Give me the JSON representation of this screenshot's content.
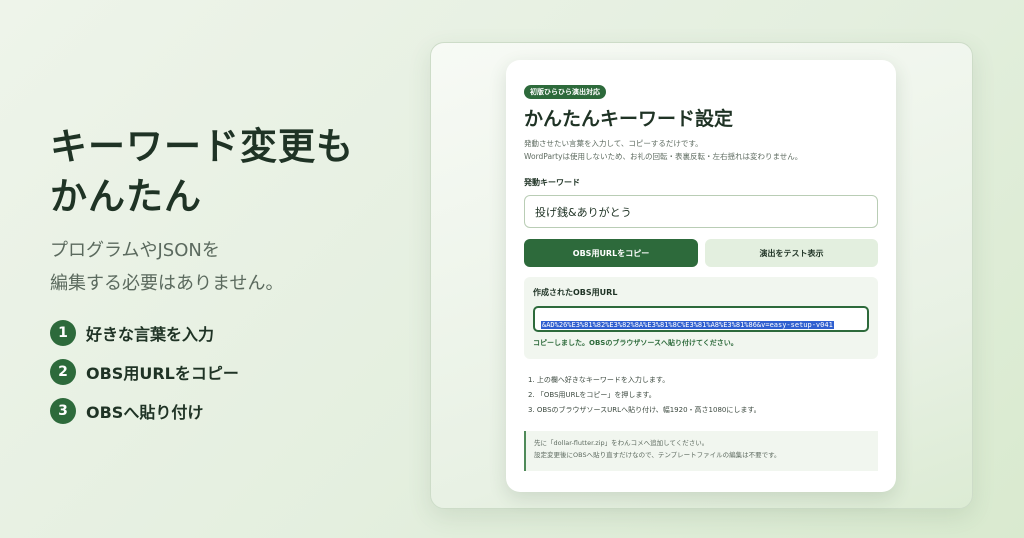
{
  "hero": {
    "title_line1": "キーワード変更も",
    "title_line2": "かんたん",
    "subtitle_line1": "プログラムやJSONを",
    "subtitle_line2": "編集する必要はありません。",
    "steps": [
      {
        "num": "1",
        "label": "好きな言葉を入力"
      },
      {
        "num": "2",
        "label": "OBS用URLをコピー"
      },
      {
        "num": "3",
        "label": "OBSへ貼り付け"
      }
    ]
  },
  "card": {
    "badge": "初版ひらひら演出対応",
    "title": "かんたんキーワード設定",
    "desc_line1": "発動させたい言葉を入力して、コピーするだけです。",
    "desc_line2": "WordPartyは使用しないため、お礼の回転・表裏反転・左右揺れは変わりません。",
    "keyword_label": "発動キーワード",
    "keyword_value": "投げ銭&ありがとう",
    "copy_button": "OBS用URLをコピー",
    "test_button": "演出をテスト表示",
    "url_label": "作成されたOBS用URL",
    "url_value": "&AD%26%E3%81%82%E3%82%8A%E3%81%8C%E3%81%A8%E3%81%86&v=easy-setup-v041",
    "copy_status": "コピーしました。OBSのブラウザソースへ貼り付けてください。",
    "instructions": [
      "1. 上の欄へ好きなキーワードを入力します。",
      "2. 「OBS用URLをコピー」を押します。",
      "3. OBSのブラウザソースURLへ貼り付け、幅1920・高さ1080にします。"
    ],
    "note_line1": "先に「dollar-flutter.zip」をわんコメへ追加してください。",
    "note_line2": "設定変更後にOBSへ貼り直すだけなので、テンプレートファイルの編集は不要です。"
  },
  "colors": {
    "accent": "#2d6a3b",
    "panel": "#f1f6ef",
    "selection": "#2f5fd0"
  }
}
